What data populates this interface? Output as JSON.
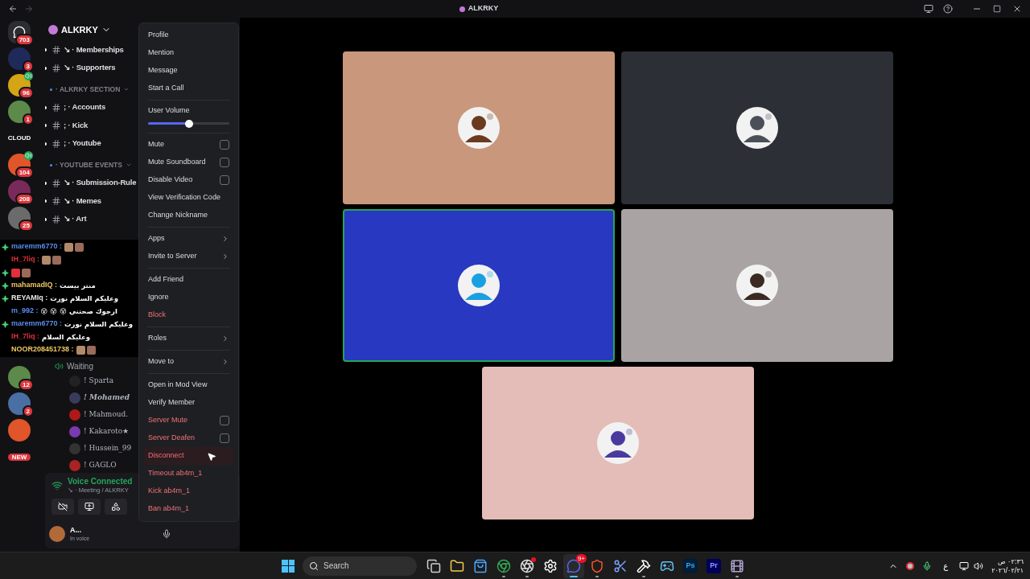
{
  "window": {
    "title": "ALKRKY"
  },
  "server_rail_top": [
    {
      "kind": "discord",
      "badge": "703",
      "voice": false
    },
    {
      "kind": "avatar",
      "badge": "3",
      "voice": false
    },
    {
      "kind": "avatar",
      "badge": "96",
      "voice": true
    },
    {
      "kind": "avatar",
      "badge": "1",
      "voice": false
    },
    {
      "kind": "wordmark",
      "label": "CLOUD",
      "voice": false
    },
    {
      "kind": "avatar",
      "badge": "104",
      "voice": true
    },
    {
      "kind": "avatar",
      "badge": "208",
      "voice": false
    },
    {
      "kind": "avatar",
      "badge": "25",
      "voice": false
    }
  ],
  "server_rail_bottom": [
    {
      "kind": "avatar",
      "badge": "12",
      "voice": false
    },
    {
      "kind": "avatar",
      "badge": "2",
      "voice": false
    },
    {
      "kind": "avatar",
      "voice": false
    },
    {
      "kind": "new",
      "label": "NEW",
      "voice": false
    }
  ],
  "server": {
    "name": "ALKRKY"
  },
  "channels": [
    {
      "kind": "text",
      "prefix": "↘ ·",
      "name": "Memberships"
    },
    {
      "kind": "text",
      "prefix": "↘ ·",
      "name": "Supporters"
    },
    {
      "kind": "category",
      "name": "· ALKRKY SECTION"
    },
    {
      "kind": "text",
      "prefix": "; ·",
      "name": "Accounts"
    },
    {
      "kind": "text",
      "prefix": "; ·",
      "name": "Kick"
    },
    {
      "kind": "text",
      "prefix": "; ·",
      "name": "Youtube"
    },
    {
      "kind": "category",
      "name": "· YOUTUBE EVENTS"
    },
    {
      "kind": "text",
      "prefix": "↘ ·",
      "name": "Submission-Rule"
    },
    {
      "kind": "text",
      "prefix": "↘ ·",
      "name": "Memes"
    },
    {
      "kind": "text",
      "prefix": "↘ ·",
      "name": "Art"
    }
  ],
  "chat_overlay": [
    {
      "kind": "emotes",
      "badge": true,
      "name": "maremm6770 :",
      "color": "#5b8def"
    },
    {
      "kind": "emotes",
      "badge": false,
      "name": "IH_7liq :",
      "color": "#e0303a"
    },
    {
      "kind": "emotes",
      "badge": true,
      "color": "#e0303a"
    },
    {
      "kind": "text",
      "badge": true,
      "name": "mahamadIQ :",
      "color": "#f0c864",
      "text": "منتر بيست"
    },
    {
      "kind": "text",
      "badge": true,
      "name": "REYAMIq :",
      "color": "#e8e8e8",
      "text": "وعليكم السلام نورت"
    },
    {
      "kind": "text",
      "badge": false,
      "name": "m_992 :",
      "color": "#5b8def",
      "text": "ارجوك صحتني 😵 😵 😵"
    },
    {
      "kind": "text",
      "badge": true,
      "name": "maremm6770 :",
      "color": "#5b8def",
      "text": "وعليكم السلام نورت"
    },
    {
      "kind": "text",
      "badge": false,
      "name": "IH_7liq :",
      "color": "#e0303a",
      "text": "وعليكم السلام"
    },
    {
      "kind": "emotes",
      "badge": false,
      "name": "NOOR208451738 :",
      "color": "#f0c864"
    }
  ],
  "voice_channel": {
    "name": "Waiting",
    "members": [
      {
        "name": "! Sparta",
        "italic": false,
        "color": "#222222"
      },
      {
        "name": "! Mohamed",
        "italic": true,
        "color": "#3a3a5a"
      },
      {
        "name": "! Mahmoud.",
        "italic": false,
        "color": "#b01818"
      },
      {
        "name": "! Kakaroto★",
        "italic": false,
        "color": "#7a3ab0"
      },
      {
        "name": "! Hussein_99",
        "italic": false,
        "color": "#333333"
      },
      {
        "name": "! GAGLO",
        "italic": false,
        "color": "#aa2222"
      }
    ]
  },
  "voice_status": {
    "title": "Voice Connected",
    "subtitle": "↘ · Meeting / ALKRKY"
  },
  "user_panel": {
    "name": "A...",
    "status": "In voice"
  },
  "context_menu": [
    {
      "kind": "item",
      "label": "Profile",
      "danger": false,
      "hovered": false
    },
    {
      "kind": "item",
      "label": "Mention",
      "danger": false,
      "hovered": false
    },
    {
      "kind": "item",
      "label": "Message",
      "danger": false,
      "hovered": false
    },
    {
      "kind": "item",
      "label": "Start a Call",
      "danger": false,
      "hovered": false
    },
    {
      "kind": "separator"
    },
    {
      "kind": "slider",
      "label": "User Volume",
      "level": 0.5
    },
    {
      "kind": "separator"
    },
    {
      "kind": "checkbox",
      "label": "Mute",
      "checked": false,
      "danger": false
    },
    {
      "kind": "checkbox",
      "label": "Mute Soundboard",
      "checked": false,
      "danger": false
    },
    {
      "kind": "checkbox",
      "label": "Disable Video",
      "checked": false,
      "danger": false
    },
    {
      "kind": "item",
      "label": "View Verification Code",
      "danger": false,
      "hovered": false
    },
    {
      "kind": "item",
      "label": "Change Nickname",
      "danger": false,
      "hovered": false
    },
    {
      "kind": "separator"
    },
    {
      "kind": "submenu",
      "label": "Apps"
    },
    {
      "kind": "submenu",
      "label": "Invite to Server"
    },
    {
      "kind": "separator"
    },
    {
      "kind": "item",
      "label": "Add Friend",
      "danger": false,
      "hovered": false
    },
    {
      "kind": "item",
      "label": "Ignore",
      "danger": false,
      "hovered": false
    },
    {
      "kind": "item",
      "label": "Block",
      "danger": true,
      "hovered": false
    },
    {
      "kind": "separator"
    },
    {
      "kind": "submenu",
      "label": "Roles"
    },
    {
      "kind": "separator"
    },
    {
      "kind": "submenu",
      "label": "Move to"
    },
    {
      "kind": "separator"
    },
    {
      "kind": "item",
      "label": "Open in Mod View",
      "danger": false,
      "hovered": false
    },
    {
      "kind": "item",
      "label": "Verify Member",
      "danger": false,
      "hovered": false
    },
    {
      "kind": "checkbox",
      "label": "Server Mute",
      "checked": false,
      "danger": true
    },
    {
      "kind": "checkbox",
      "label": "Server Deafen",
      "checked": false,
      "danger": true
    },
    {
      "kind": "item",
      "label": "Disconnect",
      "danger": true,
      "hovered": true
    },
    {
      "kind": "item",
      "label": "Timeout ab4m_1",
      "danger": true,
      "hovered": false
    },
    {
      "kind": "item",
      "label": "Kick ab4m_1",
      "danger": true,
      "hovered": false
    },
    {
      "kind": "item",
      "label": "Ban ab4m_1",
      "danger": true,
      "hovered": false
    }
  ],
  "video_tiles": [
    {
      "color": "#c9977c",
      "speaking": false
    },
    {
      "color": "#2c2f36",
      "speaking": false
    },
    {
      "color": "#2838c0",
      "speaking": true
    },
    {
      "color": "#aaa3a3",
      "speaking": false
    },
    {
      "color": "#e4bcb8",
      "speaking": false
    }
  ],
  "taskbar": {
    "search_placeholder": "Search",
    "apps": [
      {
        "kind": "taskview",
        "running": false
      },
      {
        "kind": "files",
        "running": false
      },
      {
        "kind": "store",
        "running": false
      },
      {
        "kind": "chrome",
        "running": true
      },
      {
        "kind": "obs",
        "running": true,
        "dot": true
      },
      {
        "kind": "steelseries",
        "running": false
      },
      {
        "kind": "discord",
        "running": true,
        "badge": "9+"
      },
      {
        "kind": "brave",
        "running": true
      },
      {
        "kind": "snip",
        "running": false
      },
      {
        "kind": "anvil",
        "running": true
      },
      {
        "kind": "steam",
        "running": false
      },
      {
        "kind": "ps",
        "label": "Ps",
        "running": false
      },
      {
        "kind": "pr",
        "label": "Pr",
        "running": false
      },
      {
        "kind": "media",
        "running": true
      }
    ],
    "keyboard": "ع",
    "time": "٠٢:٣٦ ص",
    "date": "٢٠٢٦/٠٢/٢١"
  }
}
